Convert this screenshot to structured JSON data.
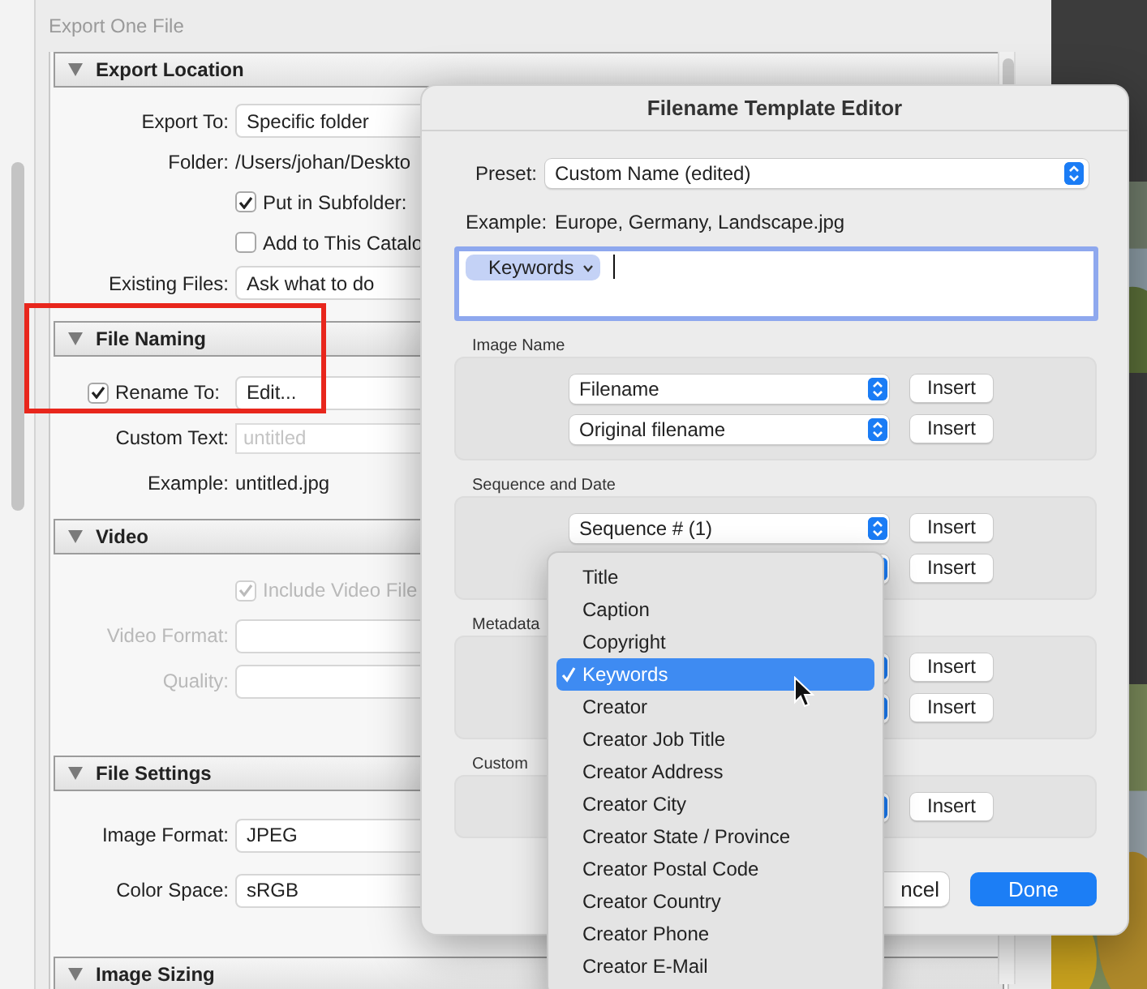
{
  "window": {
    "title": "Export One File"
  },
  "sections": [
    {
      "title": "Export Location",
      "expanded": true,
      "rows": [
        {
          "kind": "select",
          "label": "Export To:",
          "value": "Specific folder"
        },
        {
          "kind": "text",
          "label": "Folder:",
          "value": "/Users/johan/Deskto"
        },
        {
          "kind": "checkbox",
          "label": "Put in Subfolder:",
          "checked": true
        },
        {
          "kind": "checkbox",
          "label": "Add to This Catalo",
          "checked": false
        },
        {
          "kind": "select",
          "label": "Existing Files:",
          "value": "Ask what to do"
        }
      ]
    },
    {
      "title": "File Naming",
      "expanded": true,
      "rows": [
        {
          "kind": "checkbox-button",
          "label": "Rename To:",
          "checked": true,
          "value": "Edit..."
        },
        {
          "kind": "field",
          "label": "Custom Text:",
          "placeholder": "untitled"
        },
        {
          "kind": "text",
          "label": "Example:",
          "value": "untitled.jpg"
        }
      ]
    },
    {
      "title": "Video",
      "expanded": true,
      "rows": [
        {
          "kind": "checkbox",
          "label": "Include Video File",
          "checked": true,
          "disabled": true
        },
        {
          "kind": "select",
          "label": "Video Format:",
          "disabled": true
        },
        {
          "kind": "select",
          "label": "Quality:",
          "disabled": true
        }
      ]
    },
    {
      "title": "File Settings",
      "expanded": true,
      "rows": [
        {
          "kind": "select",
          "label": "Image Format:",
          "value": "JPEG"
        },
        {
          "kind": "select",
          "label": "Color Space:",
          "value": "sRGB"
        }
      ]
    },
    {
      "title": "Image Sizing",
      "expanded": true
    }
  ],
  "dialog": {
    "title": "Filename Template Editor",
    "preset": {
      "label": "Preset:",
      "value": "Custom Name (edited)"
    },
    "example": {
      "label": "Example:",
      "value": "Europe, Germany, Landscape.jpg"
    },
    "template_tokens": [
      {
        "label": "Keywords"
      }
    ],
    "groups": [
      {
        "title": "Image Name",
        "rows": [
          {
            "value": "Filename",
            "insert": "Insert"
          },
          {
            "value": "Original filename",
            "insert": "Insert"
          }
        ]
      },
      {
        "title": "Sequence and Date",
        "rows": [
          {
            "value": "Sequence # (1)",
            "insert": "Insert"
          },
          {
            "insert": "Insert"
          }
        ]
      },
      {
        "title": "Metadata",
        "rows": [
          {
            "insert": "Insert"
          },
          {
            "insert": "Insert"
          }
        ]
      },
      {
        "title": "Custom",
        "rows": [
          {
            "insert": "Insert"
          }
        ]
      }
    ],
    "buttons": [
      {
        "kind": "secondary",
        "label": "ncel"
      },
      {
        "kind": "primary",
        "label": "Done"
      }
    ]
  },
  "menu": {
    "items": [
      {
        "label": "Title",
        "selected": false
      },
      {
        "label": "Caption",
        "selected": false
      },
      {
        "label": "Copyright",
        "selected": false
      },
      {
        "label": "Keywords",
        "selected": true
      },
      {
        "label": "Creator",
        "selected": false
      },
      {
        "label": "Creator Job Title",
        "selected": false
      },
      {
        "label": "Creator Address",
        "selected": false
      },
      {
        "label": "Creator City",
        "selected": false
      },
      {
        "label": "Creator State / Province",
        "selected": false
      },
      {
        "label": "Creator Postal Code",
        "selected": false
      },
      {
        "label": "Creator Country",
        "selected": false
      },
      {
        "label": "Creator Phone",
        "selected": false
      },
      {
        "label": "Creator E-Mail",
        "selected": false
      }
    ]
  }
}
